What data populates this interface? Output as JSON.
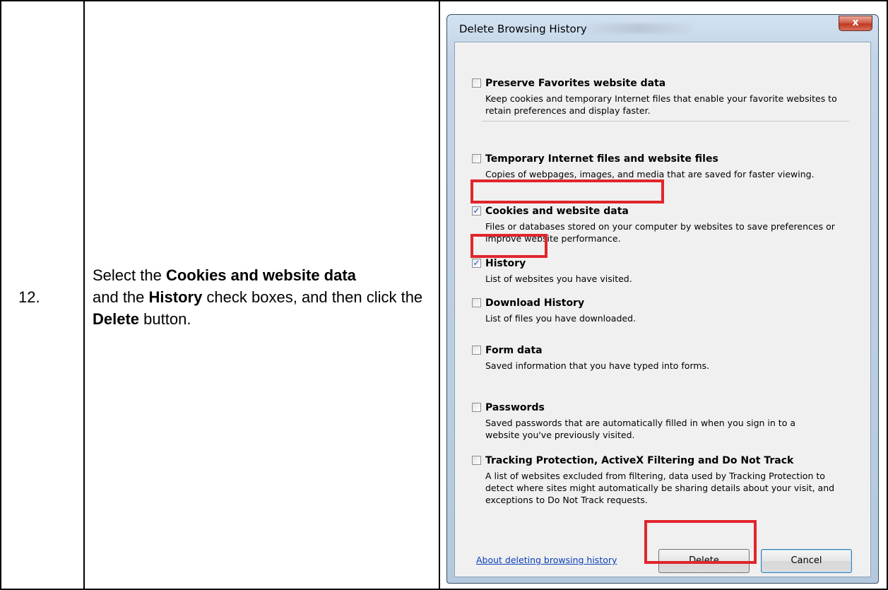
{
  "step": {
    "number": "12.",
    "instruction_parts": [
      {
        "text": "Select the ",
        "bold": false
      },
      {
        "text": "Cookies and website data",
        "bold": true
      },
      {
        "text": " and the ",
        "bold": false
      },
      {
        "text": "History",
        "bold": true
      },
      {
        "text": " check boxes, and then click the ",
        "bold": false
      },
      {
        "text": "Delete",
        "bold": true
      },
      {
        "text": " button.",
        "bold": false
      }
    ]
  },
  "dialog": {
    "title": "Delete Browsing History",
    "close_glyph": "x",
    "options": [
      {
        "title": "Preserve Favorites website data",
        "description": "Keep cookies and temporary Internet files that enable your favorite websites to retain preferences and display faster.",
        "checked": false
      },
      {
        "title": "Temporary Internet files and website files",
        "description": "Copies of webpages, images, and media that are saved for faster viewing.",
        "checked": false
      },
      {
        "title": "Cookies and website data",
        "description": "Files or databases stored on your computer by websites to save preferences or improve website performance.",
        "checked": true
      },
      {
        "title": "History",
        "description": "List of websites you have visited.",
        "checked": true
      },
      {
        "title": "Download History",
        "description": "List of files you have downloaded.",
        "checked": false
      },
      {
        "title": "Form data",
        "description": "Saved information that you have typed into forms.",
        "checked": false
      },
      {
        "title": "Passwords",
        "description": "Saved passwords that are automatically filled in when you sign in to a website you've previously visited.",
        "checked": false
      },
      {
        "title": "Tracking Protection, ActiveX Filtering and Do Not Track",
        "description": "A list of websites excluded from filtering, data used by Tracking Protection to detect where sites might automatically be sharing details about your visit, and exceptions to Do Not Track requests.",
        "checked": false
      }
    ],
    "link_text": "About deleting browsing history",
    "delete_label": "Delete",
    "cancel_label": "Cancel",
    "checkmark_glyph": "✓",
    "highlight_color": "#e0262c"
  }
}
